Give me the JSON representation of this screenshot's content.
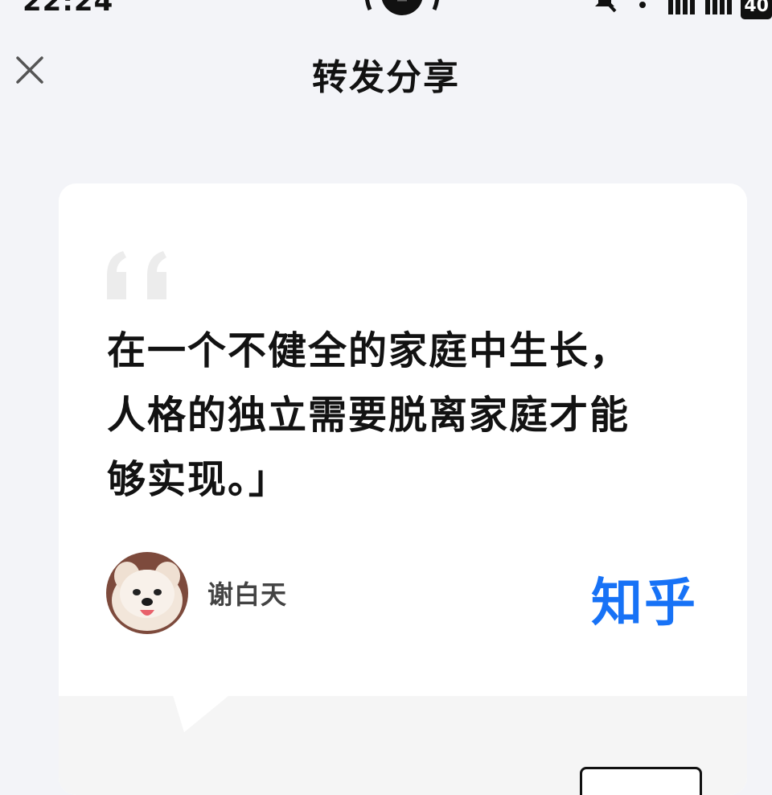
{
  "status_bar": {
    "time": "22:24",
    "battery": "40"
  },
  "header": {
    "title": "转发分享"
  },
  "card": {
    "quote_lines": [
      "在一个不健全的家庭中生长，",
      "人格的独立需要脱离家庭才能",
      "够实现。」"
    ],
    "author_name": "谢白天",
    "brand": "知乎"
  },
  "colors": {
    "brand_blue": "#1772f6",
    "background": "#f3f4f8",
    "card": "#ffffff"
  },
  "icons": {
    "close": "close-icon",
    "quote": "quote-mark-icon"
  }
}
